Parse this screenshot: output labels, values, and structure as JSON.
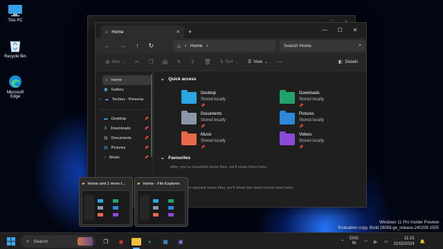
{
  "desktop": {
    "icons": [
      {
        "label": "This PC"
      },
      {
        "label": "Recycle Bin"
      },
      {
        "label": "Microsoft Edge"
      }
    ],
    "watermark": {
      "line1": "Windows 11 Pro Insider Preview",
      "line2": "Evaluation copy. Build 26058.ge_release.240209-1555"
    }
  },
  "explorer": {
    "tab_title": "Home",
    "new_tab": "+",
    "address": {
      "location": "Home"
    },
    "search": {
      "placeholder": "Search Home"
    },
    "commands": {
      "new": "New",
      "sort": "Sort",
      "view": "View",
      "more": "···",
      "details": "Details"
    },
    "sidebar": {
      "items": [
        {
          "label": "Home",
          "icon": "home-icon"
        },
        {
          "label": "Gallery",
          "icon": "gallery-icon"
        },
        {
          "label": "Techno - Persona",
          "icon": "cloud-icon"
        },
        {
          "label": "Desktop",
          "icon": "desktop-icon"
        },
        {
          "label": "Downloads",
          "icon": "downloads-icon"
        },
        {
          "label": "Documents",
          "icon": "documents-icon"
        },
        {
          "label": "Pictures",
          "icon": "pictures-icon"
        },
        {
          "label": "Music",
          "icon": "music-icon"
        }
      ]
    },
    "quick_access": {
      "title": "Quick access",
      "items": [
        {
          "name": "Desktop",
          "sub": "Stored locally",
          "color": "#2aa7e0"
        },
        {
          "name": "Downloads",
          "sub": "Stored locally",
          "color": "#22a36b"
        },
        {
          "name": "Documents",
          "sub": "Stored locally",
          "color": "#8b97a8"
        },
        {
          "name": "Pictures",
          "sub": "Stored locally",
          "color": "#2d88d8"
        },
        {
          "name": "Music",
          "sub": "Stored locally",
          "color": "#e86a4a"
        },
        {
          "name": "Videos",
          "sub": "Stored locally",
          "color": "#8a4bd6"
        }
      ]
    },
    "favourites": {
      "title": "Favourites",
      "hint": "After you've favorited some files, we'll show them here."
    },
    "recent": {
      "hint": "After you've opened some files, we'll show the most recent ones here."
    }
  },
  "thumbnails": [
    {
      "title": "Home and 1 more t..."
    },
    {
      "title": "Home - File Explorer"
    }
  ],
  "taskbar": {
    "search": "Search",
    "lang1": "ENG",
    "lang2": "IN",
    "time": "11:15",
    "date": "21/02/2024"
  }
}
